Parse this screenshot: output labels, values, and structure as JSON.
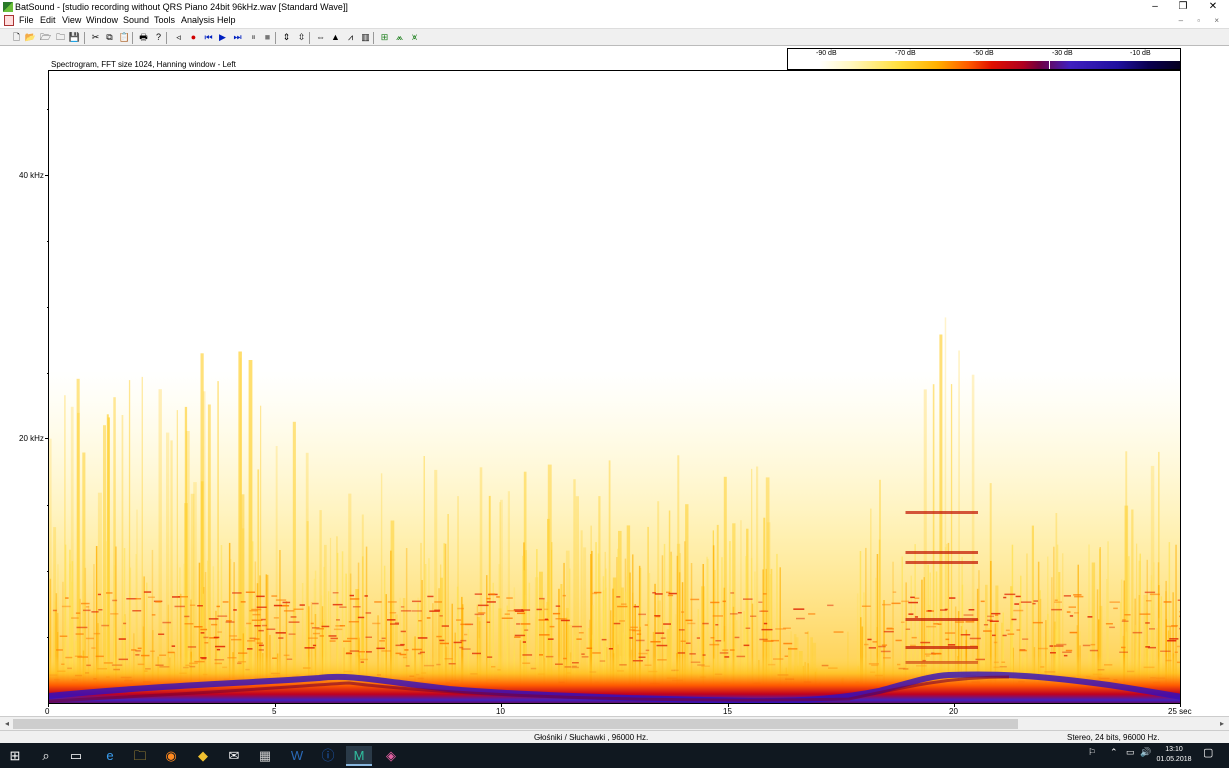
{
  "window": {
    "title": "BatSound - [studio recording without QRS Piano 24bit 96kHz.wav [Standard Wave]]",
    "controls": [
      "–",
      "❐",
      "✕"
    ]
  },
  "menu": [
    "File",
    "Edit",
    "View",
    "Window",
    "Sound",
    "Tools",
    "Analysis",
    "Help"
  ],
  "mdi_controls": "– ▫ ×",
  "toolbar": {
    "icons": [
      "new-icon",
      "open-icon",
      "open-folder-icon",
      "open-recent-icon",
      "save-icon",
      "cut-icon",
      "copy-icon",
      "paste-icon",
      "print-icon",
      "help-icon",
      "speaker-icon",
      "record-icon",
      "rewind-icon",
      "play-icon",
      "fast-forward-icon",
      "pause-icon",
      "stop-icon",
      "zoom-vertical-in-icon",
      "zoom-vertical-out-icon",
      "zoom-fit-icon",
      "spectrum-icon",
      "pulse-icon",
      "power-spectrum-icon",
      "analyse-icon",
      "settings-icon",
      "peaks-icon"
    ],
    "glyphs": [
      "🗋",
      "📂",
      "🗁",
      "🗀",
      "💾",
      "✂",
      "⧉",
      "📋",
      "🖶",
      "?",
      "◃",
      "●",
      "⏮",
      "▶",
      "⏭",
      "⏸",
      "■",
      "⇕",
      "⇳",
      "⇔",
      "▲",
      "⩘",
      "▥",
      "⊞",
      "⩕",
      "⩙"
    ]
  },
  "colorbar": {
    "labels": [
      "-90 dB",
      "-70 dB",
      "-50 dB",
      "-30 dB",
      "-10 dB"
    ],
    "colors": [
      "#ffffff",
      "#ffe040",
      "#ff5a00",
      "#b00020",
      "#4020c0",
      "#050020"
    ]
  },
  "plot": {
    "title": "Spectrogram, FFT size 1024, Hanning window - Left",
    "y_labels": [
      "40 kHz",
      "20 kHz"
    ],
    "x_labels": [
      "0",
      "5",
      "10",
      "15",
      "20",
      "25 sec"
    ]
  },
  "chart_data": {
    "type": "heatmap",
    "title": "Spectrogram, FFT size 1024, Hanning window - Left",
    "xlabel": "sec",
    "ylabel": "kHz",
    "x_ticks": [
      0,
      5,
      10,
      15,
      20,
      25
    ],
    "y_ticks": [
      20,
      40
    ],
    "xlim": [
      0,
      25
    ],
    "ylim": [
      0,
      48
    ],
    "color_scale": {
      "unit": "dB",
      "ticks": [
        -90,
        -70,
        -50,
        -30,
        -10
      ],
      "colors": [
        "#ffffff",
        "#ffe040",
        "#ff5a00",
        "#b00020",
        "#4020c0",
        "#050020"
      ]
    },
    "grid": false
  },
  "status": {
    "device": "Głośniki / Słuchawki ,  96000 Hz.",
    "format": "Stereo, 24 bits, 96000 Hz."
  },
  "taskbar": {
    "apps": [
      "windows-start-icon",
      "search-icon",
      "task-view-icon",
      "edge-icon",
      "file-explorer-icon",
      "firefox-icon",
      "app-icon",
      "mail-icon",
      "calculator-icon",
      "word-icon",
      "onepassword-icon",
      "batsound-icon",
      "maps-icon"
    ],
    "glyphs": [
      "⊞",
      "⌕",
      "▭",
      "e",
      "🗀",
      "◉",
      "◆",
      "✉",
      "▦",
      "W",
      "ⓘ",
      "M",
      "◈"
    ],
    "tray_glyphs": [
      "⚐",
      "⌃",
      "▭",
      "🔊"
    ],
    "time": "13:10",
    "date": "01.05.2018"
  }
}
